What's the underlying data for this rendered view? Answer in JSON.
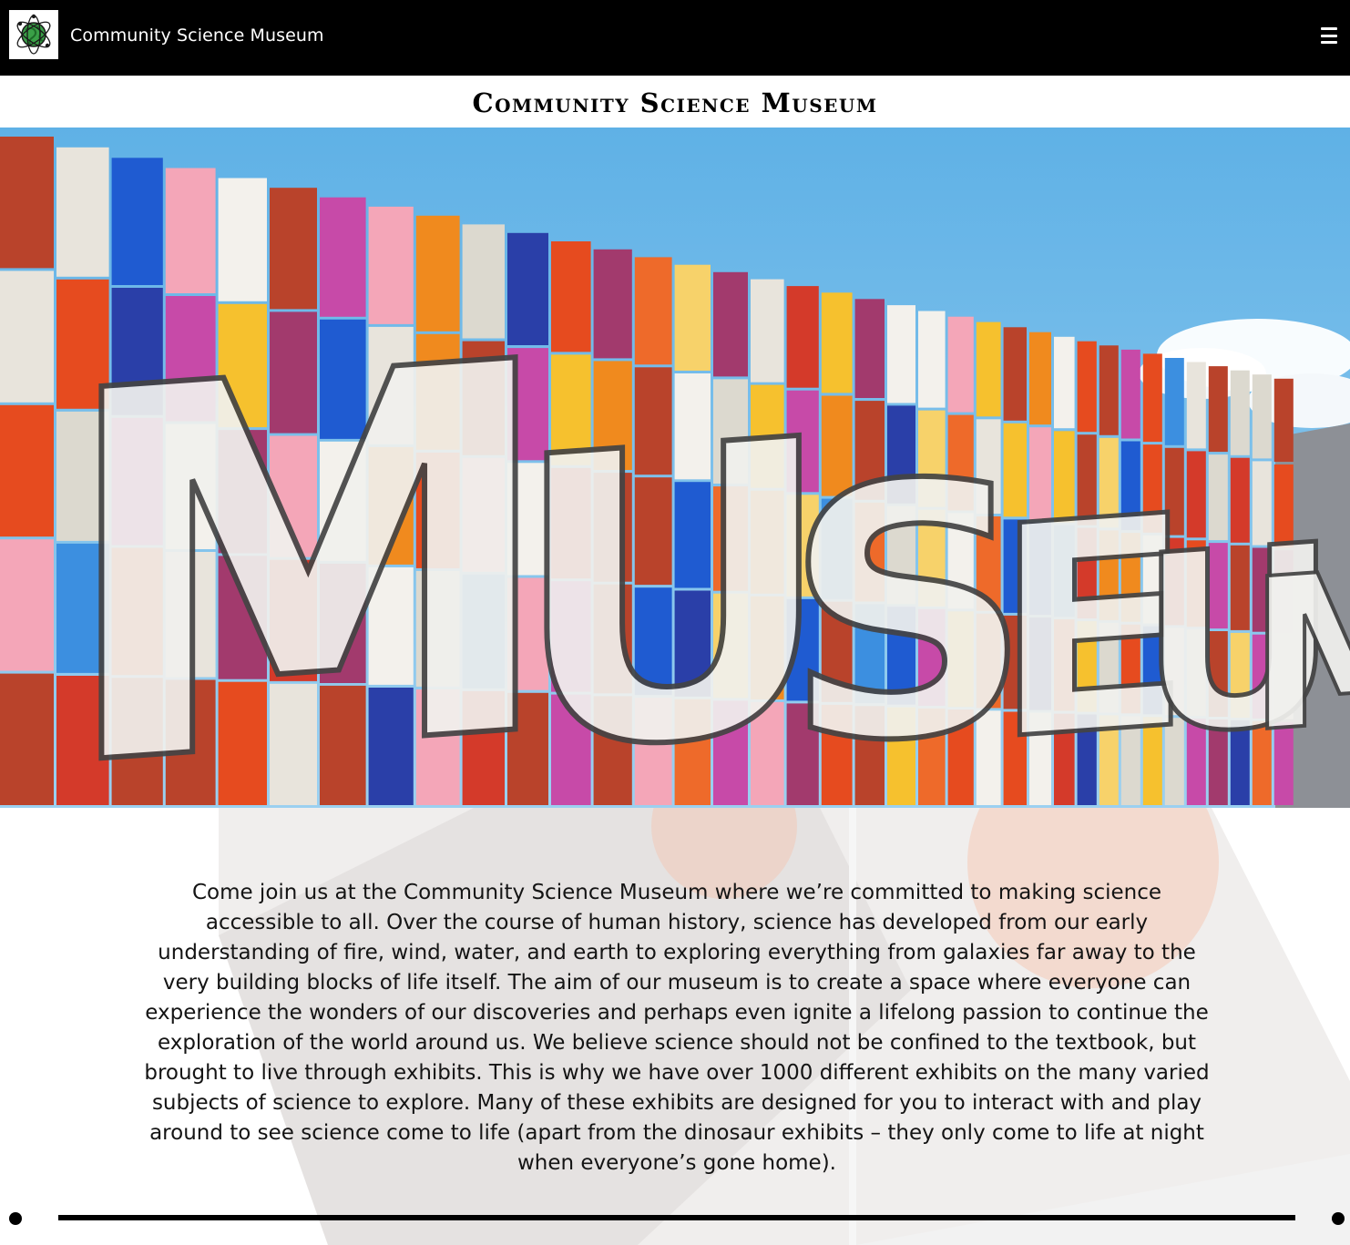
{
  "navbar": {
    "brand_name": "Community Science Museum",
    "logo_icon": "atom-globe-logo-icon",
    "menu_icon": "hamburger-menu-icon"
  },
  "page": {
    "title": "Community Science Museum"
  },
  "hero": {
    "image_description_icon": "museum-facade-image",
    "sign_text": "MUSEUM"
  },
  "intro": {
    "text": "Come join us at the Community Science Museum where we’re committed to making science accessible to all. Over the course of human history, science has developed from our early understanding of fire, wind, water, and earth to exploring everything from galaxies far away to the very building blocks of life itself. The aim of our museum is to create a space where everyone can experience the wonders of our discoveries and perhaps even ignite a lifelong passion to continue the exploration of the world around us. We believe science should not be confined to the textbook, but brought to live through exhibits. This is why we have over 1000 different exhibits on the many varied subjects of science to explore. Many of these exhibits are designed for you to interact with and play around to see science come to life (apart from the dinosaur exhibits – they only come to life at night when everyone’s gone home)."
  },
  "colors": {
    "navbar_bg": "#000000",
    "text": "#141414",
    "accent_green": "#3aa047"
  }
}
